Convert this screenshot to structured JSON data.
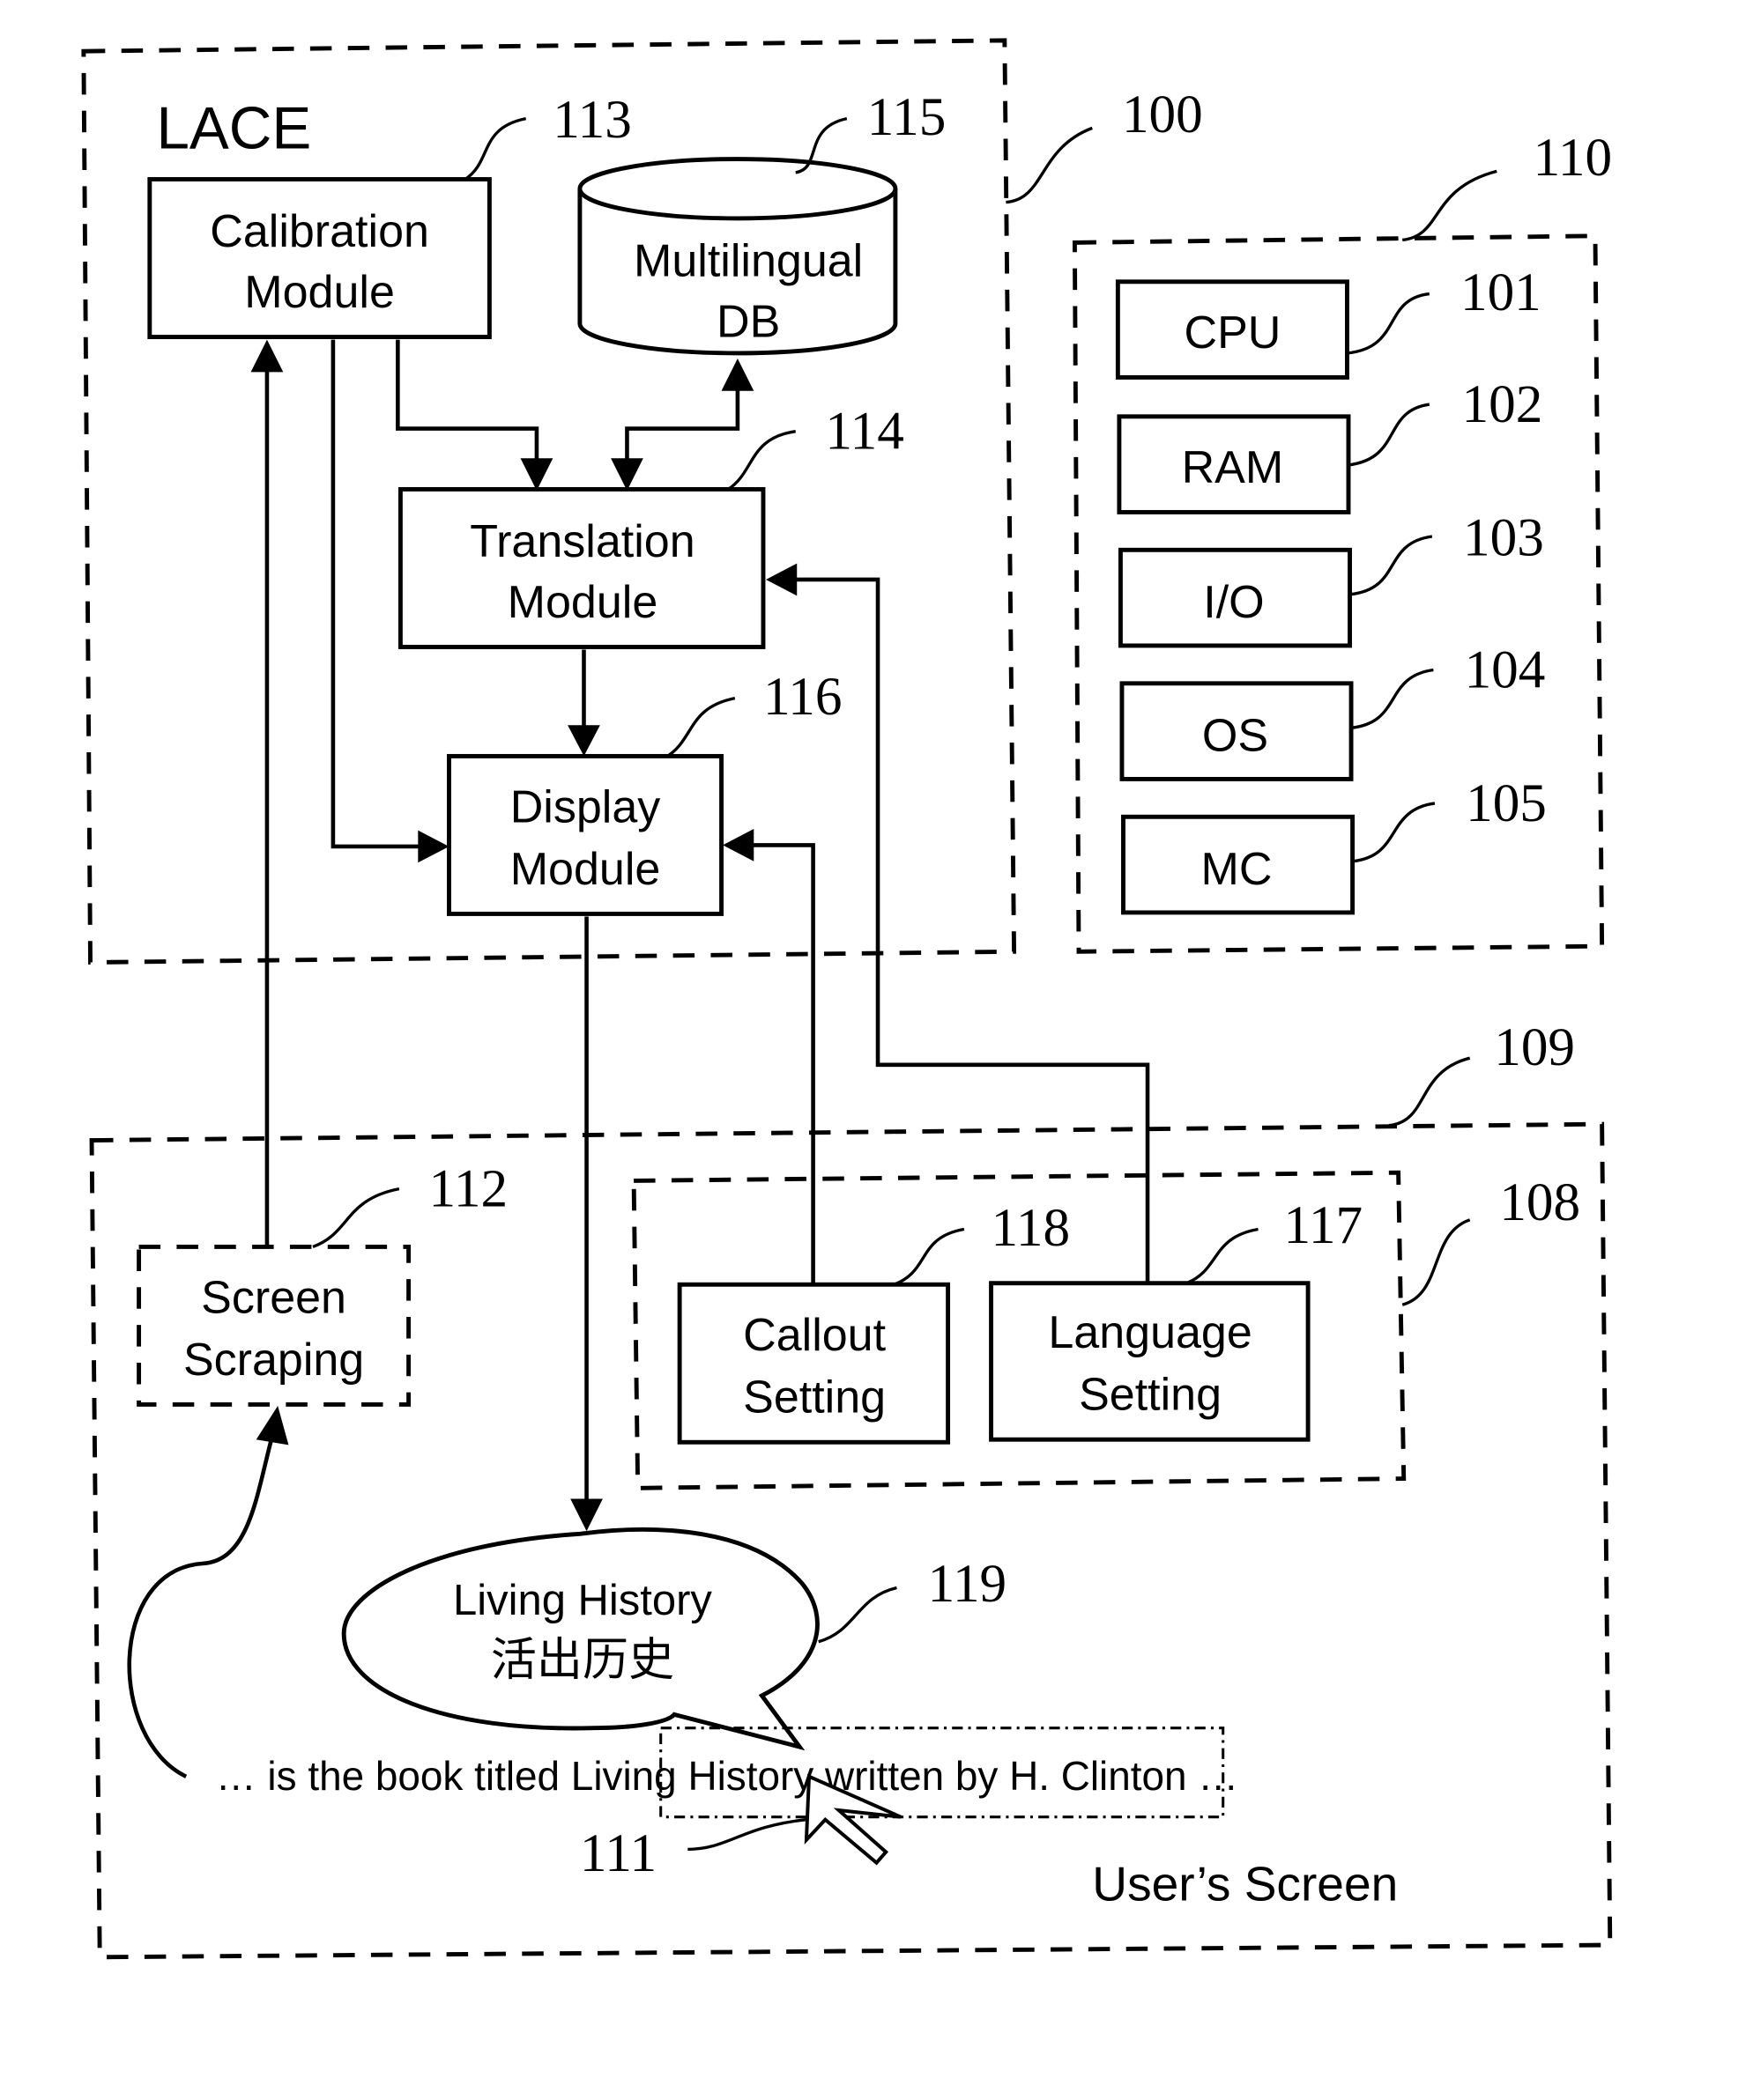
{
  "figure": {
    "system_title": "LACE",
    "modules": {
      "calibration": {
        "line1": "Calibration",
        "line2": "Module",
        "ref": "113"
      },
      "database": {
        "line1": "Multilingual",
        "line2": "DB",
        "ref": "115"
      },
      "translation": {
        "line1": "Translation",
        "line2": "Module",
        "ref": "114"
      },
      "display": {
        "line1": "Display",
        "line2": "Module",
        "ref": "116"
      }
    },
    "lace_ref": "100",
    "hardware": {
      "ref": "110",
      "items": [
        {
          "label": "CPU",
          "ref": "101"
        },
        {
          "label": "RAM",
          "ref": "102"
        },
        {
          "label": "I/O",
          "ref": "103"
        },
        {
          "label": "OS",
          "ref": "104"
        },
        {
          "label": "MC",
          "ref": "105"
        }
      ]
    },
    "user_screen": {
      "label": "User’s Screen",
      "ref": "109",
      "screen_scraping": {
        "line1": "Screen",
        "line2": "Scraping",
        "ref": "112"
      },
      "settings_group_ref": "108",
      "callout_setting": {
        "line1": "Callout",
        "line2": "Setting",
        "ref": "118"
      },
      "language_setting": {
        "line1": "Language",
        "line2": "Setting",
        "ref": "117"
      },
      "callout": {
        "english": "Living History",
        "chinese": "活出历史",
        "ref": "119"
      },
      "sentence": "… is the book titled Living History written by H. Clinton …",
      "selection_ref": "111"
    }
  }
}
